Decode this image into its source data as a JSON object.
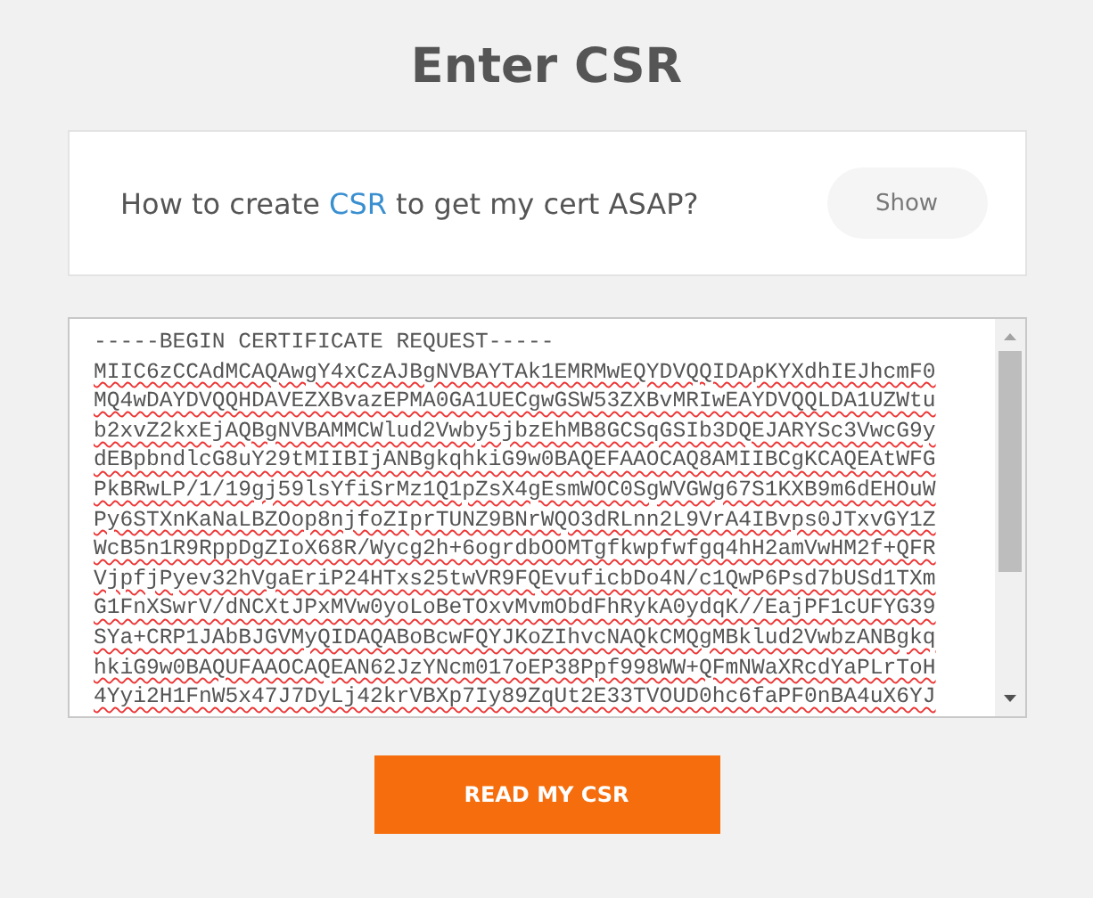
{
  "title": "Enter CSR",
  "help": {
    "question": "How to create **CSR** to get my cert ASAP?",
    "show_button": "Show"
  },
  "csr_field": {
    "header": "-----BEGIN CERTIFICATE REQUEST-----",
    "lines": [
      "MIIC6zCCAdMCAQAwgY4xCzAJBgNVBAYTAk1EMRMwEQYDVQQIDApKYXdhIEJhcmF0",
      "MQ4wDAYDVQQHDAVEZXBvazEPMA0GA1UECgwGSW53ZXBvMRIwEAYDVQQLDA1UZWtu",
      "b2xvZ2kxEjAQBgNVBAMMCWlud2Vwby5jbzEhMB8GCSqGSIb3DQEJARYSc3VwcG9y",
      "dEBpbndlcG8uY29tMIIBIjANBgkqhkiG9w0BAQEFAAOCAQ8AMIIBCgKCAQEAtWFG",
      "PkBRwLP/1/19gj59lsYfiSrMz1Q1pZsX4gEsmWOC0SgWVGWg67S1KXB9m6dEHOuW",
      "Py6STXnKaNaLBZOop8njfoZIprTUNZ9BNrWQO3dRLnn2L9VrA4IBvps0JTxvGY1Z",
      "WcB5n1R9RppDgZIoX68R/Wycg2h+6ogrdbOOMTgfkwpfwfgq4hH2amVwHM2f+QFR",
      "VjpfjPyev32hVgaEriP24HTxs25twVR9FQEvuficbDo4N/c1QwP6Psd7bUSd1TXm",
      "G1FnXSwrV/dNCXtJPxMVw0yoLoBeTOxvMvmObdFhRykA0ydqK//EajPF1cUFYG39",
      "SYa+CRP1JAbBJGVMyQIDAQABoBcwFQYJKoZIhvcNAQkCMQgMBklud2VwbzANBgkq",
      "hkiG9w0BAQUFAAOCAQEAN62JzYNcm017oEP38Ppf998WW+QFmNWaXRcdYaPLrToH",
      "4Yyi2H1FnW5x47J7DyLj42krVBXp7Iy89ZqUt2E33TVOUD0hc6faPF0nBA4uX6YJ"
    ]
  },
  "submit_button": "READ MY CSR"
}
